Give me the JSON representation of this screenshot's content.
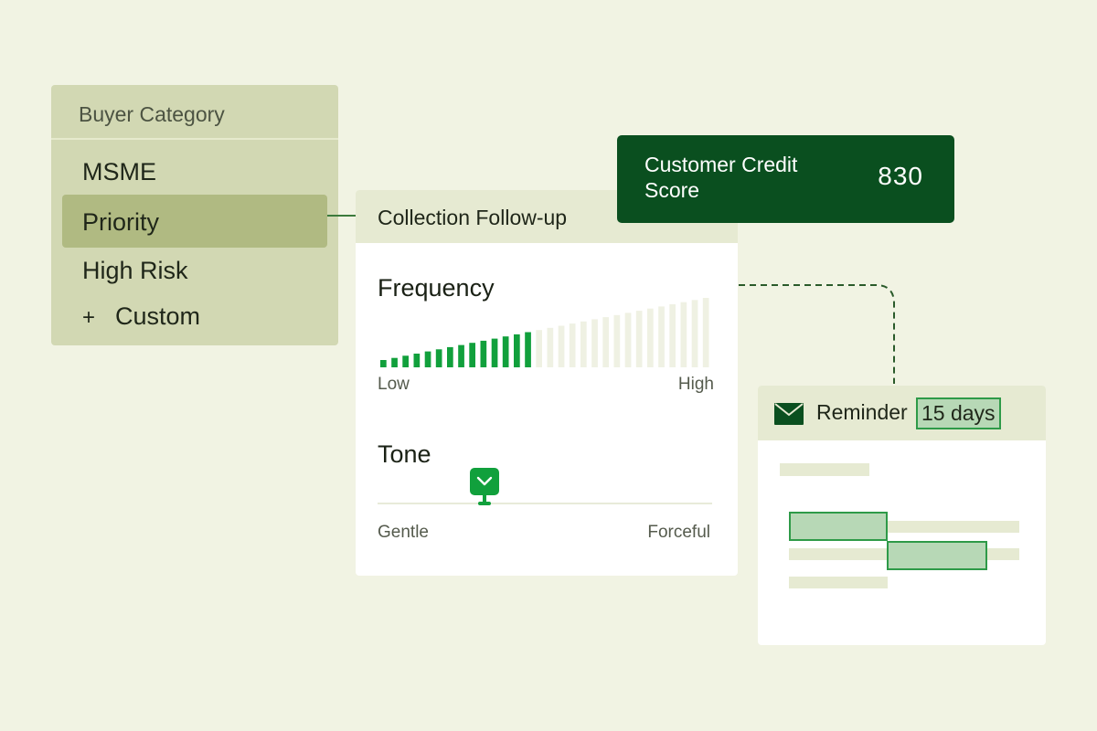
{
  "buyer_category": {
    "header": "Buyer Category",
    "items": [
      {
        "label": "MSME",
        "selected": false
      },
      {
        "label": "Priority",
        "selected": true
      },
      {
        "label": "High Risk",
        "selected": false
      }
    ],
    "custom": {
      "icon": "plus-icon",
      "glyph": "+",
      "label": "Custom"
    }
  },
  "followup": {
    "title": "Collection Follow-up",
    "frequency": {
      "title": "Frequency",
      "low_label": "Low",
      "high_label": "High",
      "total_steps": 30,
      "selected_steps": 14
    },
    "tone": {
      "title": "Tone",
      "gentle_label": "Gentle",
      "forceful_label": "Forceful",
      "value_fraction": 0.32
    }
  },
  "credit": {
    "label": "Customer Credit Score",
    "value": "830"
  },
  "reminder": {
    "icon": "mail-icon",
    "label": "Reminder",
    "days": "15 days"
  },
  "colors": {
    "background": "#f1f3e3",
    "accent_green": "#11a03c",
    "dark_green": "#0a4f1f",
    "bar_inactive": "#eff1e3",
    "highlight_fill": "#b7d8b6",
    "highlight_border": "#2e9a48"
  }
}
